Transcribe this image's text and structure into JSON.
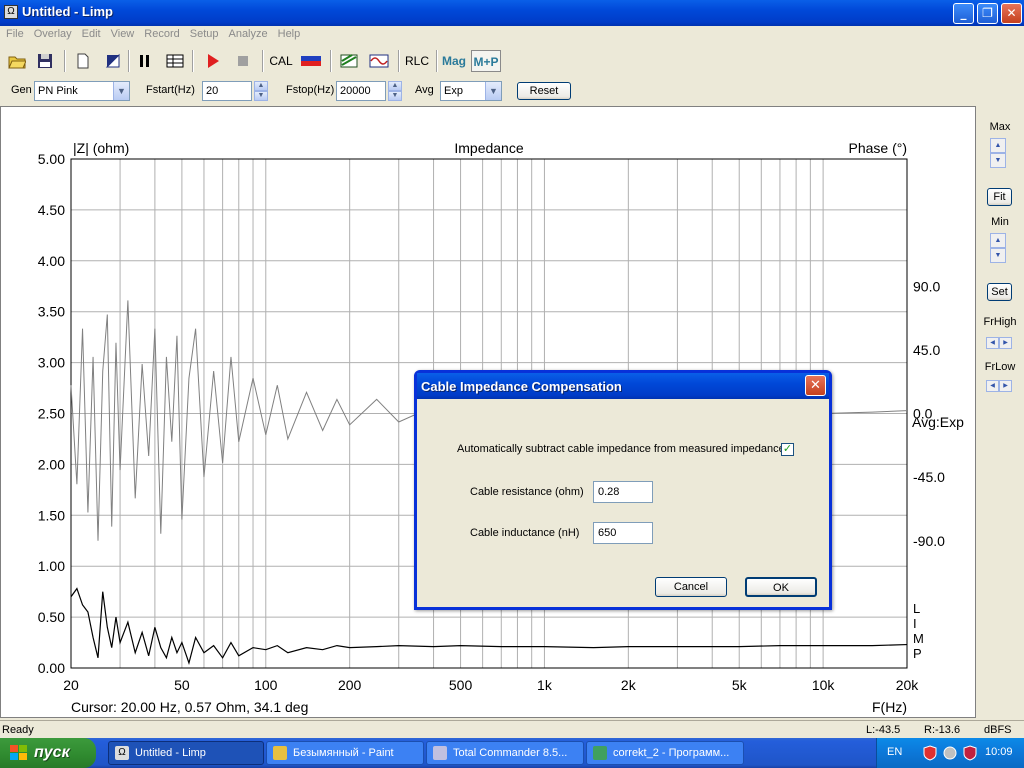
{
  "window": {
    "title": "Untitled - Limp",
    "minimize": "_",
    "maximize": "❐",
    "close": "✕"
  },
  "menu": [
    "File",
    "Overlay",
    "Edit",
    "View",
    "Record",
    "Setup",
    "Analyze",
    "Help"
  ],
  "toolbar": {
    "cal": "CAL",
    "rlc": "RLC",
    "mag": "Mag",
    "mp": "M+P",
    "accent": "#2a7a9a"
  },
  "genbar": {
    "gen_label": "Gen",
    "gen_value": "PN Pink",
    "fstart_label": "Fstart(Hz)",
    "fstart_value": "20",
    "fstop_label": "Fstop(Hz)",
    "fstop_value": "20000",
    "avg_label": "Avg",
    "avg_value": "Exp",
    "reset_label": "Reset"
  },
  "chart_data": {
    "type": "line",
    "title": "Impedance",
    "ylabel": "|Z| (ohm)",
    "ylabel_right": "Phase (°)",
    "xlabel": "F(Hz)",
    "x_scale": "log",
    "xlim": [
      20,
      20000
    ],
    "ylim": [
      0,
      5
    ],
    "ylim_right": [
      -180,
      180
    ],
    "x_ticks": [
      20,
      50,
      100,
      200,
      500,
      1000,
      2000,
      5000,
      10000,
      20000
    ],
    "x_tick_labels": [
      "20",
      "50",
      "100",
      "200",
      "500",
      "1k",
      "2k",
      "5k",
      "10k",
      "20k"
    ],
    "y_ticks": [
      0.0,
      0.5,
      1.0,
      1.5,
      2.0,
      2.5,
      3.0,
      3.5,
      4.0,
      4.5,
      5.0
    ],
    "y_tick_labels": [
      "0.00",
      "0.50",
      "1.00",
      "1.50",
      "2.00",
      "2.50",
      "3.00",
      "3.50",
      "4.00",
      "4.50",
      "5.00"
    ],
    "y_right_ticks": [
      90,
      45,
      0,
      -45,
      -90
    ],
    "y_right_tick_labels": [
      "90.0",
      "45.0",
      "0.0",
      "-45.0",
      "-90.0"
    ],
    "grid": true,
    "series": [
      {
        "color": "#000000",
        "x": [
          20,
          21,
          22,
          23,
          24,
          25,
          26,
          27,
          28,
          29,
          30,
          32,
          34,
          36,
          38,
          40,
          42,
          44,
          46,
          48,
          50,
          53,
          56,
          60,
          65,
          70,
          75,
          80,
          90,
          100,
          110,
          120,
          140,
          160,
          180,
          200,
          250,
          300,
          400,
          500,
          700,
          1000,
          1500,
          2000,
          3000,
          5000,
          7000,
          10000,
          15000,
          20000
        ],
        "values": [
          0.7,
          0.78,
          0.62,
          0.55,
          0.3,
          0.1,
          0.75,
          0.4,
          0.2,
          0.5,
          0.25,
          0.45,
          0.15,
          0.35,
          0.12,
          0.4,
          0.2,
          0.1,
          0.3,
          0.15,
          0.25,
          0.05,
          0.3,
          0.15,
          0.22,
          0.1,
          0.25,
          0.12,
          0.2,
          0.18,
          0.22,
          0.15,
          0.2,
          0.18,
          0.22,
          0.2,
          0.21,
          0.22,
          0.21,
          0.22,
          0.21,
          0.21,
          0.2,
          0.21,
          0.21,
          0.21,
          0.22,
          0.22,
          0.22,
          0.23
        ]
      },
      {
        "color": "#808080",
        "x": [
          20,
          21,
          22,
          23,
          24,
          25,
          26,
          27,
          28,
          29,
          30,
          32,
          34,
          36,
          38,
          40,
          42,
          44,
          46,
          48,
          50,
          53,
          56,
          60,
          65,
          70,
          75,
          80,
          90,
          100,
          110,
          120,
          140,
          160,
          180,
          200,
          250,
          300,
          400,
          500,
          700,
          1000,
          1500,
          2000,
          3000,
          5000,
          7000,
          10000,
          15000,
          20000
        ],
        "values": [
          20,
          -50,
          60,
          -70,
          40,
          -90,
          30,
          70,
          -80,
          50,
          -40,
          80,
          -60,
          35,
          -30,
          60,
          -85,
          40,
          -20,
          55,
          -75,
          25,
          60,
          -45,
          30,
          -35,
          40,
          -20,
          25,
          -15,
          20,
          -18,
          15,
          -12,
          10,
          -8,
          10,
          -6,
          5,
          -4,
          3,
          -2,
          2,
          0,
          1,
          0,
          1,
          0,
          1,
          2
        ]
      }
    ],
    "annotations": [
      "Avg:Exp",
      "L",
      "I",
      "M",
      "P"
    ],
    "cursor": "Cursor: 20.00 Hz, 0.57 Ohm, 34.1 deg"
  },
  "right_panel": {
    "max": "Max",
    "fit": "Fit",
    "min": "Min",
    "set": "Set",
    "frhigh": "FrHigh",
    "frlow": "FrLow"
  },
  "status": {
    "ready": "Ready",
    "left": "L:-43.5",
    "right": "R:-13.6",
    "unit": "dBFS"
  },
  "dialog": {
    "title": "Cable Impedance Compensation",
    "auto_label": "Automatically subtract cable impedance from measured impedance",
    "auto_checked": "✓",
    "resistance_label": "Cable resistance (ohm)",
    "resistance_value": "0.28",
    "inductance_label": "Cable inductance (nH)",
    "inductance_value": "650",
    "cancel": "Cancel",
    "ok": "OK"
  },
  "taskbar": {
    "start": "пуск",
    "tasks": [
      "Untitled - Limp",
      "Безымянный - Paint",
      "Total Commander 8.5...",
      "correkt_2 - Программ..."
    ],
    "lang": "EN",
    "clock": "10:09"
  }
}
